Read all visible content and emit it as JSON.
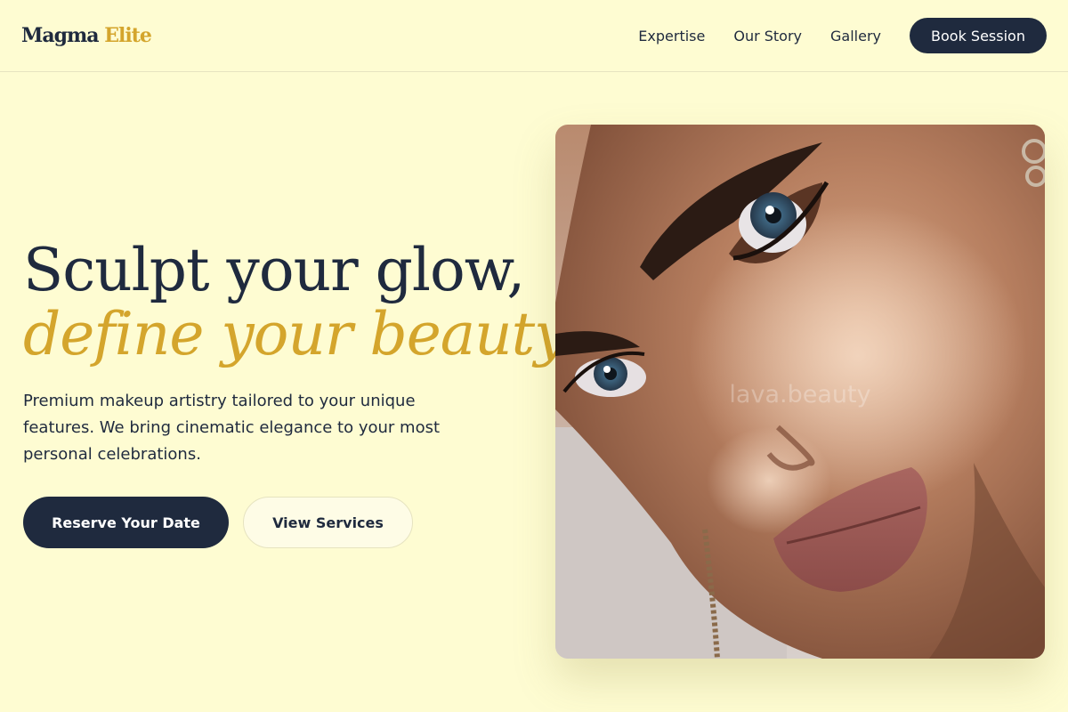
{
  "brand": {
    "name": "Magma",
    "accent": "Elite"
  },
  "nav": {
    "links": [
      "Expertise",
      "Our Story",
      "Gallery"
    ],
    "cta_label": "Book Session"
  },
  "hero": {
    "headline": "Sculpt your glow,",
    "headline_accent": "define your beauty.",
    "tagline": "Premium makeup artistry tailored to your unique features. We bring cinematic elegance to your most personal celebrations.",
    "primary_cta": "Reserve Your Date",
    "secondary_cta": "View Services"
  },
  "image": {
    "watermark": "lava.beauty"
  },
  "colors": {
    "background": "#fefcd2",
    "navy": "#1f2a3e",
    "gold": "#d4a52c"
  }
}
